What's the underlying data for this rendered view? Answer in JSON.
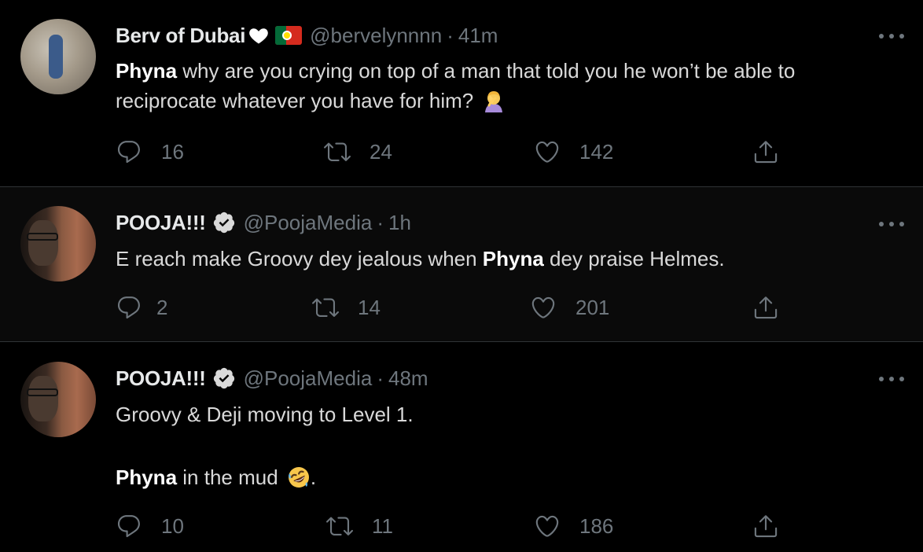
{
  "colors": {
    "background": "#000000",
    "text": "#d9d9d9",
    "muted": "#6e767d",
    "divider": "#2f3336",
    "verified_badge": "#d9d9d9"
  },
  "tweets": [
    {
      "name": "Berv of Dubai",
      "name_emojis": [
        "white-heart-icon",
        "portugal-flag-icon"
      ],
      "handle": "@bervelynnnn",
      "separator": "·",
      "time": "41m",
      "verified": false,
      "body_bold_1": "Phyna",
      "body_text_1": " why are you crying on top of a man that told you he won’t be able to reciprocate whatever you have for him?",
      "body_emoji": "woman-facepalming-icon",
      "replies": "16",
      "retweets": "24",
      "likes": "142"
    },
    {
      "name": "POOJA!!!",
      "handle": "@PoojaMedia",
      "separator": "·",
      "time": "1h",
      "verified": true,
      "body_text_1": "E reach make Groovy dey jealous when ",
      "body_bold_1": "Phyna",
      "body_text_2": " dey praise Helmes.",
      "replies": "2",
      "retweets": "14",
      "likes": "201"
    },
    {
      "name": "POOJA!!!",
      "handle": "@PoojaMedia",
      "separator": "·",
      "time": "48m",
      "verified": true,
      "body_line_1": "Groovy & Deji moving to Level 1.",
      "body_bold_1": "Phyna",
      "body_text_2": " in the mud",
      "body_emoji": "rolling-on-floor-laughing-icon",
      "body_end": ".",
      "replies": "10",
      "retweets": "11",
      "likes": "186"
    }
  ]
}
